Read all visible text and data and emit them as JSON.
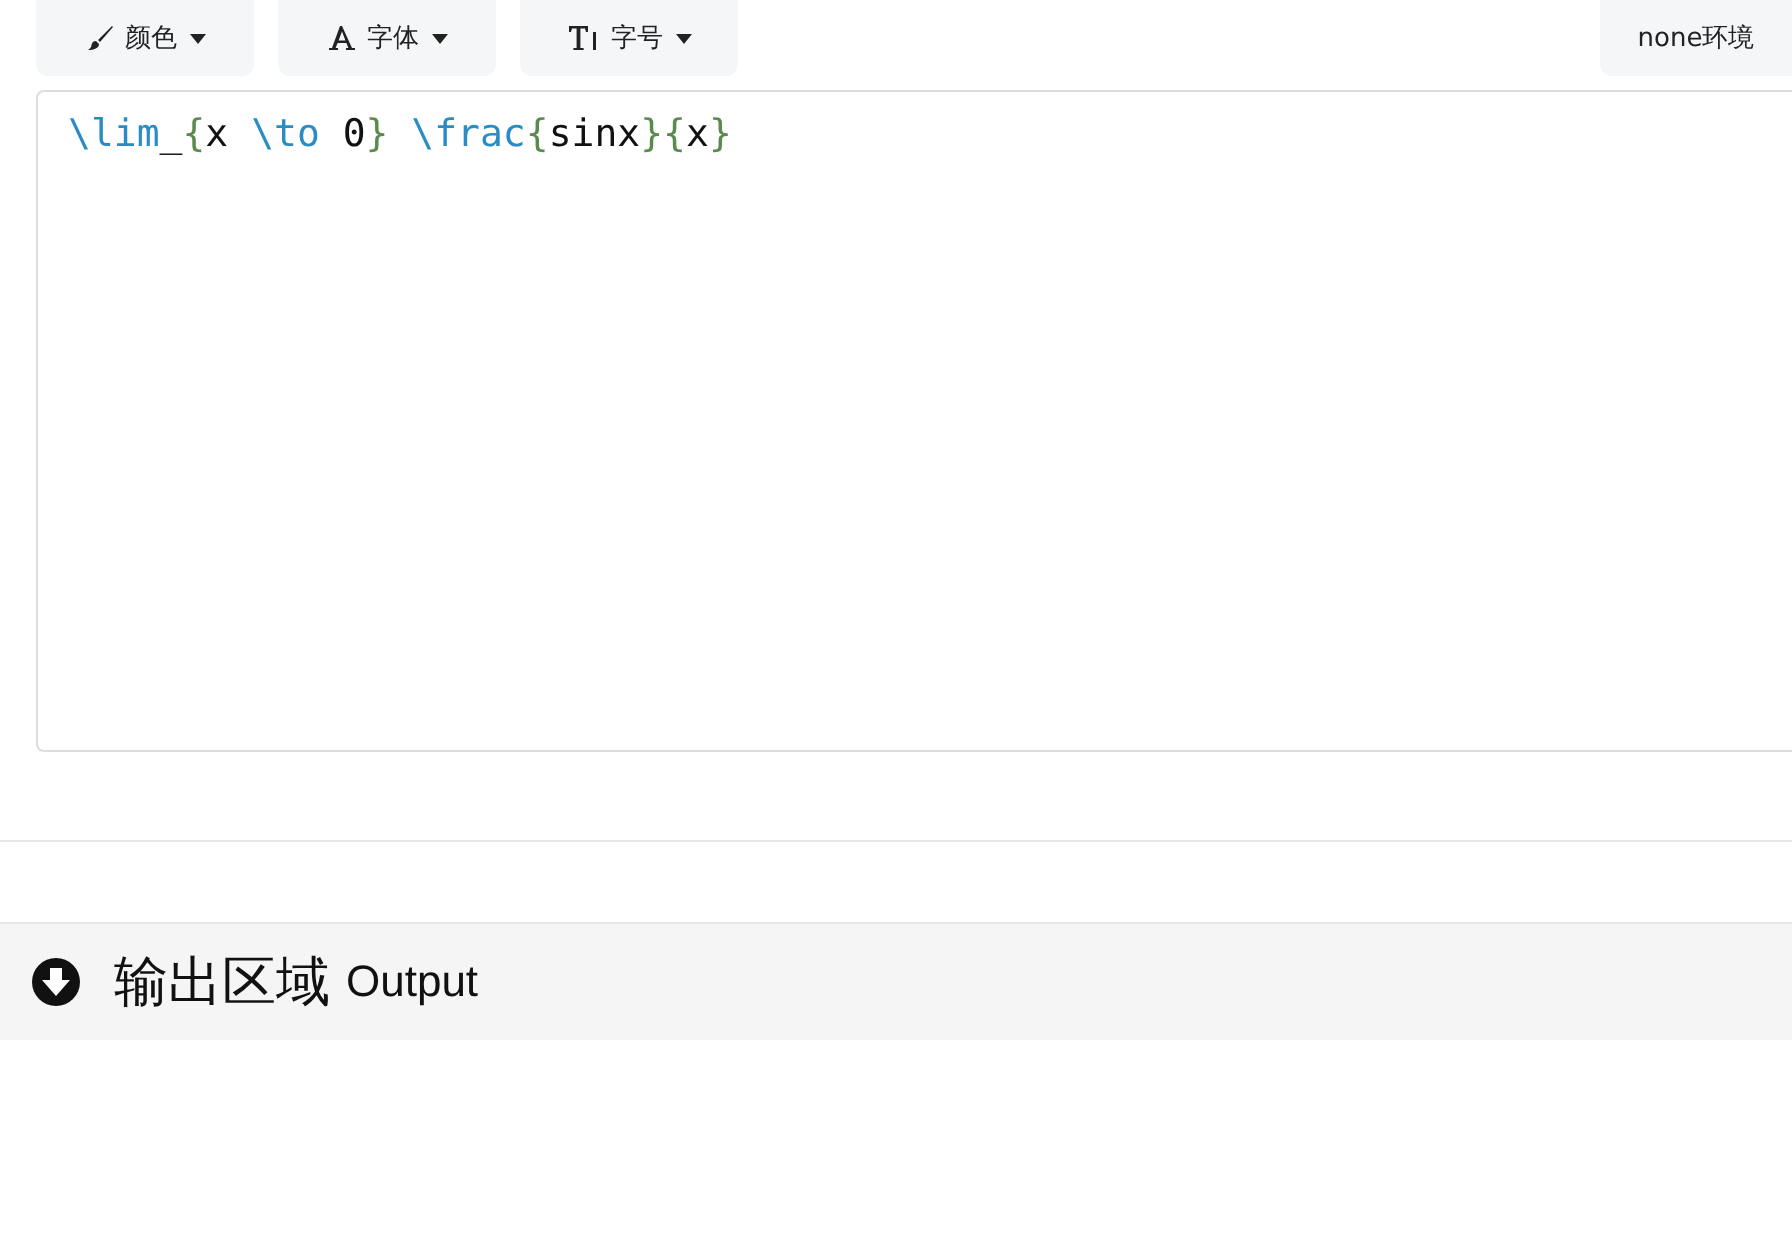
{
  "toolbar": {
    "buttons": [
      {
        "kind": "brush",
        "label": "颜色",
        "dropdown": true
      },
      {
        "kind": "font",
        "label": "字体",
        "dropdown": true
      },
      {
        "kind": "size",
        "label": "字号",
        "dropdown": true
      }
    ],
    "environment_button": "none环境"
  },
  "editor": {
    "tokens": [
      {
        "kind": "command",
        "text": "\\lim"
      },
      {
        "kind": "text",
        "text": "_"
      },
      {
        "kind": "brace",
        "text": "{"
      },
      {
        "kind": "text",
        "text": "x "
      },
      {
        "kind": "command",
        "text": "\\to"
      },
      {
        "kind": "text",
        "text": " 0"
      },
      {
        "kind": "brace",
        "text": "}"
      },
      {
        "kind": "command",
        "text": " \\frac"
      },
      {
        "kind": "brace",
        "text": "{"
      },
      {
        "kind": "text",
        "text": "sinx"
      },
      {
        "kind": "brace",
        "text": "}{"
      },
      {
        "kind": "text",
        "text": "x"
      },
      {
        "kind": "brace",
        "text": "}"
      }
    ]
  },
  "output": {
    "title": "输出区域",
    "subtitle": "Output"
  }
}
